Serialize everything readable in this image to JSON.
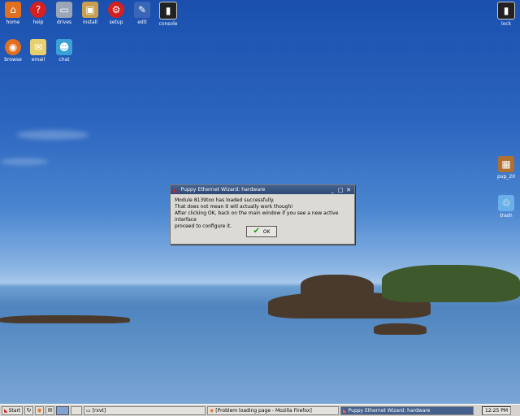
{
  "desktop": {
    "icons": [
      {
        "label": "home",
        "icon": "home-icon"
      },
      {
        "label": "help",
        "icon": "help-icon"
      },
      {
        "label": "drives",
        "icon": "drives-icon"
      },
      {
        "label": "install",
        "icon": "install-icon"
      },
      {
        "label": "setup",
        "icon": "setup-icon"
      },
      {
        "label": "edit",
        "icon": "edit-icon"
      },
      {
        "label": "console",
        "icon": "console-icon"
      },
      {
        "label": "lock",
        "icon": "lock-icon"
      },
      {
        "label": "browse",
        "icon": "browse-icon"
      },
      {
        "label": "email",
        "icon": "email-icon"
      },
      {
        "label": "chat",
        "icon": "chat-icon"
      },
      {
        "label": "pup_20",
        "icon": "package-icon"
      },
      {
        "label": "trash",
        "icon": "trash-icon"
      }
    ]
  },
  "dialog": {
    "title": "Puppy Ethernet Wizard: hardware",
    "line1": "Module 8139too has loaded successfully.",
    "line2": "That does not mean it will actually work though!",
    "line3": "After clicking OK, back on the main window if you see a new active interface",
    "line4": "proceed to configure it.",
    "ok_label": "OK",
    "minimize_glyph": "_",
    "maximize_glyph": "□",
    "close_glyph": "✕"
  },
  "taskbar": {
    "start_label": "Start",
    "tasks": [
      {
        "label": "[rxvt]"
      },
      {
        "label": "[Problem loading page - Mozilla Firefox]"
      },
      {
        "label": "Puppy Ethernet Wizard: hardware"
      }
    ],
    "clock": "12:25 PM"
  },
  "colors": {
    "titlebar": "#2f4a75",
    "dialog_bg": "#dcdad5",
    "taskbar_bg": "#d6d3ce",
    "active_task": "#44618e"
  }
}
